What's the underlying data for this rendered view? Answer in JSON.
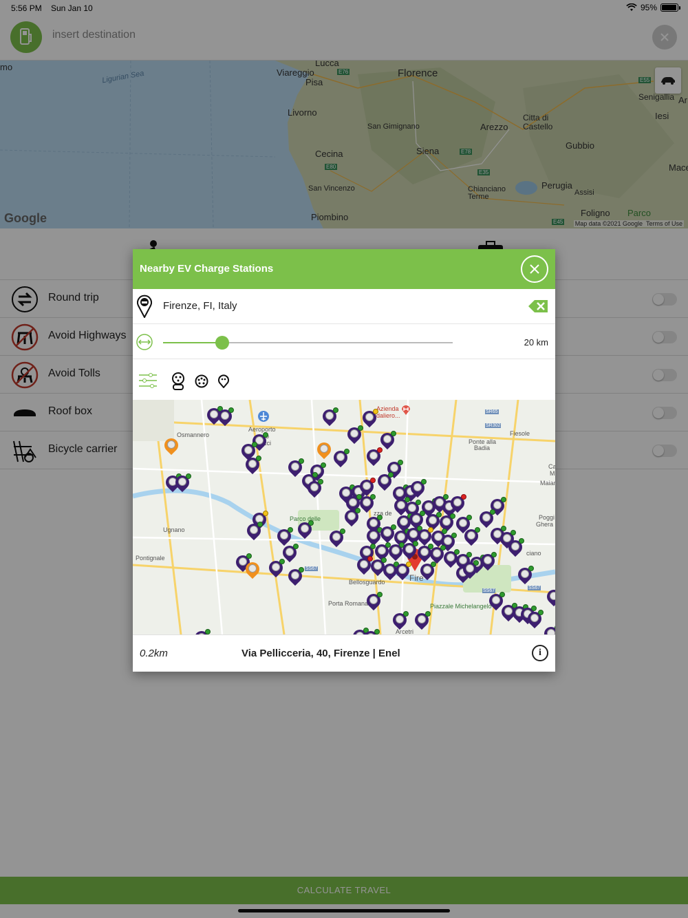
{
  "status_bar": {
    "time": "5:56 PM",
    "date": "Sun Jan 10",
    "battery_text": "95%",
    "battery_level": 0.95
  },
  "header": {
    "destination_placeholder": "insert destination"
  },
  "big_map": {
    "labels": [
      "Lucca",
      "Viareggio",
      "Pisa",
      "Florence",
      "Livorno",
      "San Gimignano",
      "Siena",
      "Arezzo",
      "Citta di Castello",
      "Cecina",
      "San Vincenzo",
      "Piombino",
      "Chianciano Terme",
      "Perugia",
      "Assisi",
      "Gubbio",
      "Senigallia",
      "Iesi",
      "Foligno",
      "Parco",
      "Ligurian Sea",
      "mo",
      "Ar",
      "Mace"
    ],
    "road_badges": [
      "E76",
      "E80",
      "E78",
      "E35",
      "E55",
      "E45"
    ],
    "attribution": "Map data ©2021 Google",
    "terms": "Terms of Use",
    "logo": "Google"
  },
  "options": [
    {
      "label": "Round trip",
      "icon": "round-trip-icon",
      "enabled": false
    },
    {
      "label": "Avoid Highways",
      "icon": "avoid-highways-icon",
      "enabled": false
    },
    {
      "label": "Avoid Tolls",
      "icon": "avoid-tolls-icon",
      "enabled": false
    },
    {
      "label": "Roof box",
      "icon": "roof-box-icon",
      "enabled": false
    },
    {
      "label": "Bicycle carrier",
      "icon": "bicycle-carrier-icon",
      "enabled": false
    }
  ],
  "calculate_button": "CALCULATE TRAVEL",
  "modal": {
    "title": "Nearby EV Charge Stations",
    "location": "Firenze, FI, Italy",
    "range_value": "20 km",
    "range_fraction": 0.205,
    "map_labels": [
      "Aeroporto",
      "go",
      "cci",
      "Osmannero",
      "Azienda",
      "daliero...",
      "Fiesole",
      "Ponte alla",
      "Badia",
      "Parco delle",
      "Ugnano",
      "Pontignale",
      "Bellosguardo",
      "Porta Romana",
      "Piazzale Michelangelo",
      "Poggi",
      "Ghera",
      "ciano",
      "Maiar",
      "Ca",
      "M",
      "Arcetri",
      "zza de",
      "Fire",
      "SR65",
      "SR302",
      "SS67",
      "SS67",
      "SS67"
    ],
    "footer": {
      "distance": "0.2km",
      "address": "Via Pellicceria, 40, Firenze | Enel"
    }
  },
  "colors": {
    "accent": "#7cc04a",
    "marker": "#3d1f6f",
    "marker_alt": "#f0901e"
  }
}
